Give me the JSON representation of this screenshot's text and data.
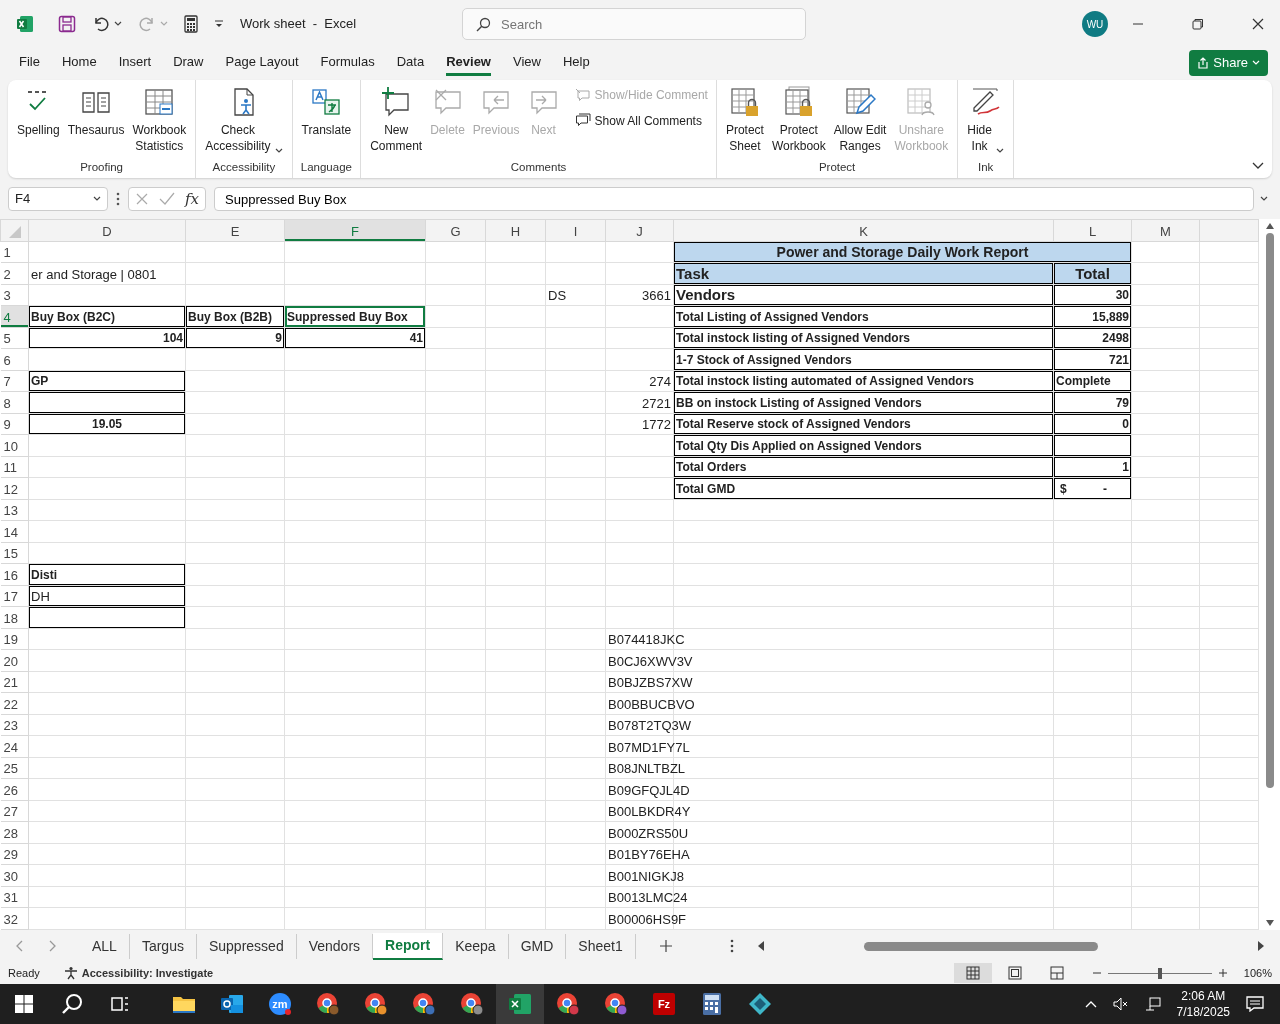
{
  "window": {
    "title": "Work sheet  -  Excel",
    "search_placeholder": "Search",
    "avatar": "WU"
  },
  "menu": [
    {
      "label": "File",
      "selected": false
    },
    {
      "label": "Home",
      "selected": false
    },
    {
      "label": "Insert",
      "selected": false
    },
    {
      "label": "Draw",
      "selected": false
    },
    {
      "label": "Page Layout",
      "selected": false
    },
    {
      "label": "Formulas",
      "selected": false
    },
    {
      "label": "Data",
      "selected": false
    },
    {
      "label": "Review",
      "selected": true
    },
    {
      "label": "View",
      "selected": false
    },
    {
      "label": "Help",
      "selected": false
    }
  ],
  "share_button": "Share",
  "ribbon": [
    {
      "label": "Proofing",
      "commands": [
        {
          "kind": "large",
          "label": "Spelling",
          "disabled": false
        },
        {
          "kind": "large",
          "label": "Thesaurus",
          "disabled": false
        },
        {
          "kind": "large",
          "label": "Workbook\nStatistics",
          "disabled": false
        }
      ]
    },
    {
      "label": "Accessibility",
      "commands": [
        {
          "kind": "large",
          "label": "Check\nAccessibility",
          "disabled": false,
          "dropdown": true
        }
      ]
    },
    {
      "label": "Language",
      "commands": [
        {
          "kind": "large",
          "label": "Translate",
          "disabled": false
        }
      ]
    },
    {
      "label": "Comments",
      "commands": [
        {
          "kind": "large",
          "label": "New\nComment",
          "disabled": false
        },
        {
          "kind": "large",
          "label": "Delete",
          "disabled": true
        },
        {
          "kind": "large",
          "label": "Previous",
          "disabled": true
        },
        {
          "kind": "large",
          "label": "Next",
          "disabled": true
        },
        {
          "kind": "small",
          "label": "Show/Hide Comment",
          "disabled": true
        },
        {
          "kind": "small",
          "label": "Show All Comments",
          "disabled": false
        }
      ]
    },
    {
      "label": "Protect",
      "commands": [
        {
          "kind": "large",
          "label": "Protect\nSheet",
          "disabled": false
        },
        {
          "kind": "large",
          "label": "Protect\nWorkbook",
          "disabled": false
        },
        {
          "kind": "large",
          "label": "Allow Edit\nRanges",
          "disabled": false
        },
        {
          "kind": "large",
          "label": "Unshare\nWorkbook",
          "disabled": true
        }
      ]
    },
    {
      "label": "Ink",
      "commands": [
        {
          "kind": "large",
          "label": "Hide\nInk",
          "disabled": false,
          "dropdown": true
        }
      ]
    }
  ],
  "formula_bar": {
    "name_box": "F4",
    "function_label": "fx",
    "formula": "Suppressed Buy Box"
  },
  "columns": [
    {
      "label": "D",
      "selected": false
    },
    {
      "label": "E",
      "selected": false
    },
    {
      "label": "F",
      "selected": true
    },
    {
      "label": "G",
      "selected": false
    },
    {
      "label": "H",
      "selected": false
    },
    {
      "label": "I",
      "selected": false
    },
    {
      "label": "J",
      "selected": false
    },
    {
      "label": "K",
      "selected": false
    },
    {
      "label": "L",
      "selected": false
    },
    {
      "label": "M",
      "selected": false
    }
  ],
  "rows": [
    {
      "label": "1",
      "selected": false,
      "cells": [
        null,
        null,
        null,
        null,
        null,
        null,
        null,
        {
          "kind": "title",
          "text": "Power and Storage Daily Work Report",
          "bold": true,
          "fill": true,
          "boxed": true,
          "merge": true
        },
        null,
        null
      ]
    },
    {
      "label": "2",
      "selected": false,
      "cells": [
        {
          "kind": "text",
          "text": "er and Storage | 0801",
          "overflow": true
        },
        null,
        null,
        null,
        null,
        null,
        null,
        {
          "kind": "heading",
          "text": "Task",
          "bold": true,
          "fill": true,
          "boxed": true
        },
        {
          "kind": "heading_centered",
          "text": "Total",
          "bold": true,
          "fill": true,
          "boxed": true
        },
        null
      ]
    },
    {
      "label": "3",
      "selected": false,
      "cells": [
        null,
        null,
        null,
        null,
        null,
        {
          "kind": "text",
          "text": "DS"
        },
        {
          "kind": "number",
          "text": "3661"
        },
        {
          "kind": "heading",
          "text": "Vendors",
          "bold": true,
          "boxed": true
        },
        {
          "kind": "number",
          "text": "30",
          "bold": true,
          "boxed": true
        },
        null
      ]
    },
    {
      "label": "4",
      "selected": true,
      "cells": [
        {
          "kind": "text",
          "text": "Buy Box (B2C)",
          "bold": true,
          "boxed": true
        },
        {
          "kind": "text",
          "text": "Buy Box (B2B)",
          "bold": true,
          "boxed": true
        },
        {
          "kind": "text",
          "text": "Suppressed Buy Box",
          "bold": true,
          "boxed": true
        },
        null,
        null,
        null,
        null,
        {
          "kind": "text",
          "text": "Total Listing of Assigned Vendors",
          "bold": true,
          "boxed": true
        },
        {
          "kind": "number",
          "text": "15,889",
          "bold": true,
          "boxed": true
        },
        null
      ]
    },
    {
      "label": "5",
      "selected": false,
      "cells": [
        {
          "kind": "number",
          "text": "104",
          "bold": true,
          "boxed": true
        },
        {
          "kind": "number",
          "text": "9",
          "bold": true,
          "boxed": true
        },
        {
          "kind": "number",
          "text": "41",
          "bold": true,
          "boxed": true
        },
        null,
        null,
        null,
        null,
        {
          "kind": "text",
          "text": "Total instock listing of Assigned Vendors",
          "bold": true,
          "boxed": true
        },
        {
          "kind": "number",
          "text": "2498",
          "bold": true,
          "boxed": true
        },
        null
      ]
    },
    {
      "label": "6",
      "selected": false,
      "cells": [
        null,
        null,
        null,
        null,
        null,
        null,
        null,
        {
          "kind": "text",
          "text": "1-7 Stock of Assigned Vendors",
          "bold": true,
          "boxed": true
        },
        {
          "kind": "number",
          "text": "721",
          "bold": true,
          "boxed": true
        },
        null
      ]
    },
    {
      "label": "7",
      "selected": false,
      "cells": [
        {
          "kind": "text",
          "text": "GP",
          "bold": true,
          "boxed": true
        },
        null,
        null,
        null,
        null,
        null,
        {
          "kind": "number",
          "text": "274"
        },
        {
          "kind": "text",
          "text": "Total instock listing automated of Assigned Vendors",
          "bold": true,
          "boxed": true
        },
        {
          "kind": "text",
          "text": "Complete",
          "bold": true,
          "boxed": true
        },
        null
      ]
    },
    {
      "label": "8",
      "selected": false,
      "cells": [
        {
          "kind": "text",
          "boxed": true
        },
        null,
        null,
        null,
        null,
        null,
        {
          "kind": "number",
          "text": "2721"
        },
        {
          "kind": "text",
          "text": "BB on instock Listing of Assigned Vendors",
          "bold": true,
          "boxed": true
        },
        {
          "kind": "number",
          "text": "79",
          "bold": true,
          "boxed": true
        },
        null
      ]
    },
    {
      "label": "9",
      "selected": false,
      "cells": [
        {
          "kind": "centered",
          "text": "19.05",
          "bold": true,
          "boxed": true
        },
        null,
        null,
        null,
        null,
        null,
        {
          "kind": "number",
          "text": "1772"
        },
        {
          "kind": "text",
          "text": "Total Reserve stock of Assigned Vendors",
          "bold": true,
          "boxed": true
        },
        {
          "kind": "number",
          "text": "0",
          "bold": true,
          "boxed": true
        },
        null
      ]
    },
    {
      "label": "10",
      "selected": false,
      "cells": [
        null,
        null,
        null,
        null,
        null,
        null,
        null,
        {
          "kind": "text",
          "text": "Total Qty Dis Applied on Assigned Vendors",
          "bold": true,
          "boxed": true
        },
        {
          "kind": "text",
          "boxed": true
        },
        null
      ]
    },
    {
      "label": "11",
      "selected": false,
      "cells": [
        null,
        null,
        null,
        null,
        null,
        null,
        null,
        {
          "kind": "text",
          "text": "Total Orders",
          "bold": true,
          "boxed": true
        },
        {
          "kind": "number",
          "text": "1",
          "bold": true,
          "boxed": true
        },
        null
      ]
    },
    {
      "label": "12",
      "selected": false,
      "cells": [
        null,
        null,
        null,
        null,
        null,
        null,
        null,
        {
          "kind": "text",
          "text": "Total GMD",
          "bold": true,
          "boxed": true
        },
        {
          "kind": "currency",
          "prefix": "$",
          "text": "-",
          "bold": true,
          "boxed": true
        },
        null
      ]
    },
    {
      "label": "13",
      "selected": false,
      "cells": [
        null,
        null,
        null,
        null,
        null,
        null,
        null,
        null,
        null,
        null
      ]
    },
    {
      "label": "14",
      "selected": false,
      "cells": [
        null,
        null,
        null,
        null,
        null,
        null,
        null,
        null,
        null,
        null
      ]
    },
    {
      "label": "15",
      "selected": false,
      "cells": [
        null,
        null,
        null,
        null,
        null,
        null,
        null,
        null,
        null,
        null
      ]
    },
    {
      "label": "16",
      "selected": false,
      "cells": [
        {
          "kind": "text",
          "text": "Disti",
          "bold": true,
          "boxed": true
        },
        null,
        null,
        null,
        null,
        null,
        null,
        null,
        null,
        null
      ]
    },
    {
      "label": "17",
      "selected": false,
      "cells": [
        {
          "kind": "text",
          "text": "DH",
          "boxed": true
        },
        null,
        null,
        null,
        null,
        null,
        null,
        null,
        null,
        null
      ]
    },
    {
      "label": "18",
      "selected": false,
      "cells": [
        {
          "kind": "text",
          "boxed": true
        },
        null,
        null,
        null,
        null,
        null,
        null,
        null,
        null,
        null
      ]
    },
    {
      "label": "19",
      "selected": false,
      "cells": [
        null,
        null,
        null,
        null,
        null,
        null,
        {
          "kind": "text",
          "text": "B074418JKC",
          "overflow": true
        },
        null,
        null,
        null
      ]
    },
    {
      "label": "20",
      "selected": false,
      "cells": [
        null,
        null,
        null,
        null,
        null,
        null,
        {
          "kind": "text",
          "text": "B0CJ6XWV3V",
          "overflow": true
        },
        null,
        null,
        null
      ]
    },
    {
      "label": "21",
      "selected": false,
      "cells": [
        null,
        null,
        null,
        null,
        null,
        null,
        {
          "kind": "text",
          "text": "B0BJZBS7XW",
          "overflow": true
        },
        null,
        null,
        null
      ]
    },
    {
      "label": "22",
      "selected": false,
      "cells": [
        null,
        null,
        null,
        null,
        null,
        null,
        {
          "kind": "text",
          "text": "B00BBUCBVO",
          "overflow": true
        },
        null,
        null,
        null
      ]
    },
    {
      "label": "23",
      "selected": false,
      "cells": [
        null,
        null,
        null,
        null,
        null,
        null,
        {
          "kind": "text",
          "text": "B078T2TQ3W",
          "overflow": true
        },
        null,
        null,
        null
      ]
    },
    {
      "label": "24",
      "selected": false,
      "cells": [
        null,
        null,
        null,
        null,
        null,
        null,
        {
          "kind": "text",
          "text": "B07MD1FY7L",
          "overflow": true
        },
        null,
        null,
        null
      ]
    },
    {
      "label": "25",
      "selected": false,
      "cells": [
        null,
        null,
        null,
        null,
        null,
        null,
        {
          "kind": "text",
          "text": "B08JNLTBZL",
          "overflow": true
        },
        null,
        null,
        null
      ]
    },
    {
      "label": "26",
      "selected": false,
      "cells": [
        null,
        null,
        null,
        null,
        null,
        null,
        {
          "kind": "text",
          "text": "B09GFQJL4D",
          "overflow": true
        },
        null,
        null,
        null
      ]
    },
    {
      "label": "27",
      "selected": false,
      "cells": [
        null,
        null,
        null,
        null,
        null,
        null,
        {
          "kind": "text",
          "text": "B00LBKDR4Y",
          "overflow": true
        },
        null,
        null,
        null
      ]
    },
    {
      "label": "28",
      "selected": false,
      "cells": [
        null,
        null,
        null,
        null,
        null,
        null,
        {
          "kind": "text",
          "text": "B000ZRS50U",
          "overflow": true
        },
        null,
        null,
        null
      ]
    },
    {
      "label": "29",
      "selected": false,
      "cells": [
        null,
        null,
        null,
        null,
        null,
        null,
        {
          "kind": "text",
          "text": "B01BY76EHA",
          "overflow": true
        },
        null,
        null,
        null
      ]
    },
    {
      "label": "30",
      "selected": false,
      "cells": [
        null,
        null,
        null,
        null,
        null,
        null,
        {
          "kind": "text",
          "text": "B001NIGKJ8",
          "overflow": true
        },
        null,
        null,
        null
      ]
    },
    {
      "label": "31",
      "selected": false,
      "cells": [
        null,
        null,
        null,
        null,
        null,
        null,
        {
          "kind": "text",
          "text": "B0013LMC24",
          "overflow": true
        },
        null,
        null,
        null
      ]
    },
    {
      "label": "32",
      "selected": false,
      "cells": [
        null,
        null,
        null,
        null,
        null,
        null,
        {
          "kind": "text",
          "text": "B00006HS9F",
          "overflow": true
        },
        null,
        null,
        null
      ]
    }
  ],
  "sheets": [
    {
      "label": "ALL",
      "selected": false
    },
    {
      "label": "Targus",
      "selected": false
    },
    {
      "label": "Suppressed",
      "selected": false
    },
    {
      "label": "Vendors",
      "selected": false
    },
    {
      "label": "Report",
      "selected": true
    },
    {
      "label": "Keepa",
      "selected": false
    },
    {
      "label": "GMD",
      "selected": false
    },
    {
      "label": "Sheet1",
      "selected": false
    }
  ],
  "status_bar": {
    "mode": "Ready",
    "accessibility": "Accessibility: Investigate",
    "views": [
      {
        "kind": "normal",
        "selected": true
      },
      {
        "kind": "page_layout",
        "selected": false
      },
      {
        "kind": "page_break",
        "selected": false
      }
    ],
    "zoom": {
      "level": 0.5,
      "reading": "106%"
    }
  },
  "taskbar": {
    "apps": [
      {
        "kind": "explorer",
        "active": false
      },
      {
        "kind": "outlook",
        "active": false
      },
      {
        "kind": "zoom",
        "active": false,
        "label": "zm"
      },
      {
        "kind": "chrome",
        "active": false,
        "color": "#8a5a2b"
      },
      {
        "kind": "chrome",
        "active": false,
        "color": "#e8912c"
      },
      {
        "kind": "chrome",
        "active": false,
        "color": "#3d6fb6"
      },
      {
        "kind": "chrome",
        "active": false,
        "color": "#8c8c8c"
      },
      {
        "kind": "excel",
        "active": true
      },
      {
        "kind": "chrome",
        "active": false,
        "color": "#d2394a"
      },
      {
        "kind": "chrome",
        "active": false,
        "color": "#8f5bd1"
      },
      {
        "kind": "filezilla",
        "active": false,
        "label": "Fz"
      },
      {
        "kind": "calculator",
        "active": false
      },
      {
        "kind": "app",
        "active": false
      }
    ],
    "time": "2:06 AM",
    "date": "7/18/2025"
  }
}
